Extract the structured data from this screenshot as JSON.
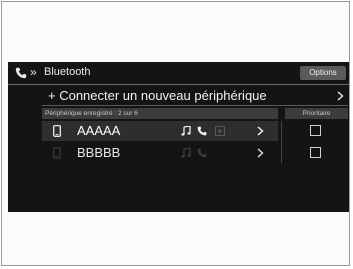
{
  "header": {
    "chevrons": "»",
    "title": "Bluetooth",
    "options_label": "Options"
  },
  "connect": {
    "label": "+ Connecter un nouveau périphérique"
  },
  "sections": {
    "registered_devices": "Périphérique enregistré : 2 sur 6",
    "priority": "Prioritaire"
  },
  "devices": [
    {
      "name": "AAAAA",
      "active": true,
      "priority": false
    },
    {
      "name": "BBBBB",
      "active": false,
      "priority": false
    }
  ],
  "colors": {
    "screen_bg": "#141414",
    "active_row": "#2e2e2e",
    "section_bg": "#3c3c3c",
    "options_bg": "#5a5a5a"
  },
  "icons": [
    "phone-icon",
    "music-note-icon",
    "call-icon",
    "play-icon",
    "chevron-right-icon",
    "checkbox"
  ]
}
